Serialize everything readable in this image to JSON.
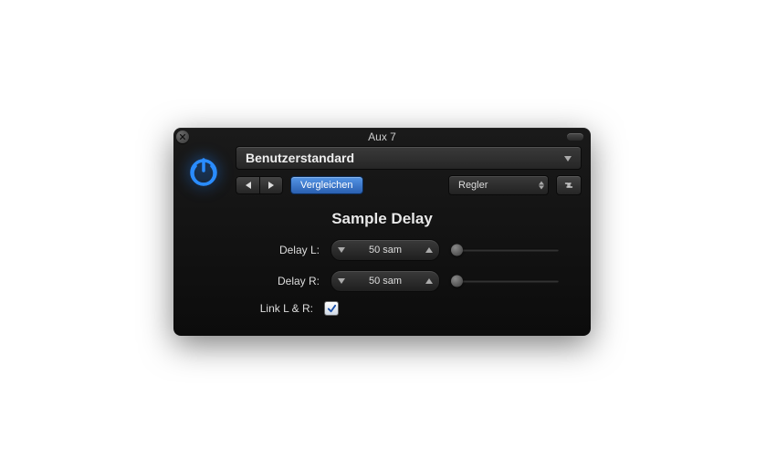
{
  "window": {
    "title": "Aux 7"
  },
  "header": {
    "preset": "Benutzerstandard",
    "compare_label": "Vergleichen",
    "view_label": "Regler"
  },
  "plugin": {
    "title": "Sample Delay",
    "params": {
      "delay_l": {
        "label": "Delay L:",
        "value": "50 sam"
      },
      "delay_r": {
        "label": "Delay R:",
        "value": "50 sam"
      },
      "link": {
        "label": "Link L & R:",
        "checked": true
      }
    }
  }
}
